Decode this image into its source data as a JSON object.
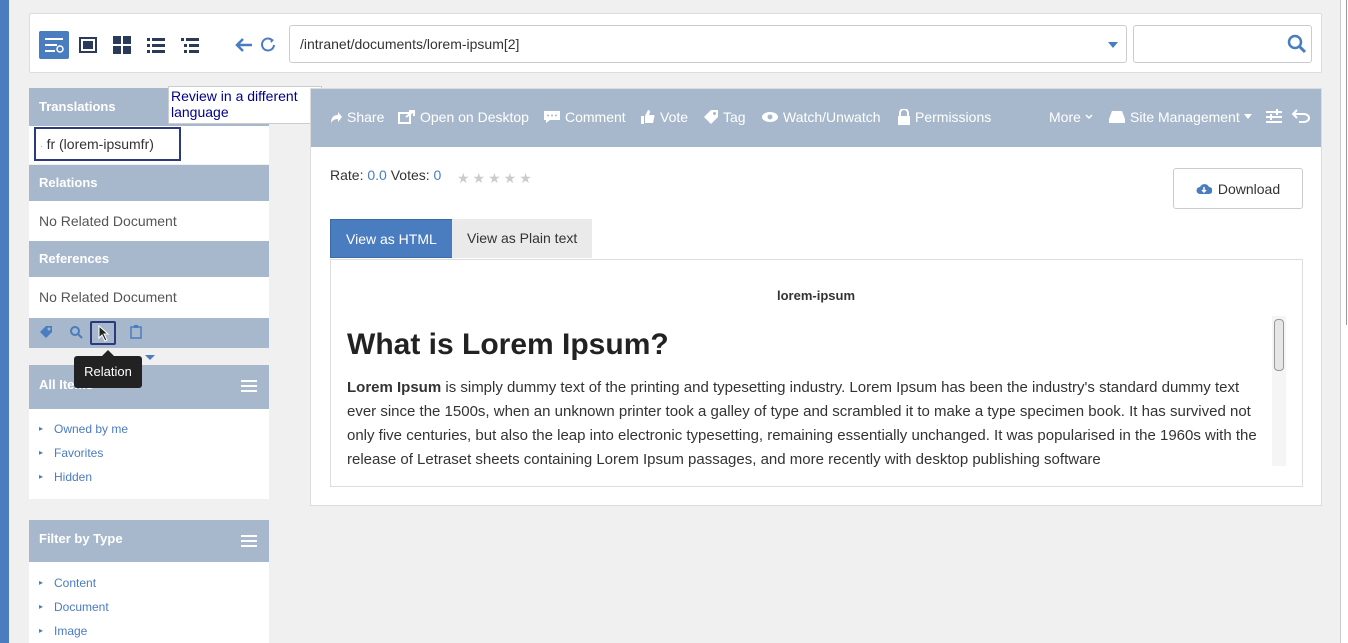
{
  "toolbar": {
    "path_value": "/intranet/documents/lorem-ipsum[2]",
    "search_value": ""
  },
  "sidebar": {
    "translations_heading": "Translations",
    "translations_tooltip": "Review in a different language",
    "translation_item": "fr (lorem-ipsumfr)",
    "relations_heading": "Relations",
    "relations_empty": "No Related Document",
    "references_heading": "References",
    "references_empty": "No Related Document",
    "relation_tooltip": "Relation",
    "all_items_heading": "All Items",
    "all_items": [
      "Owned by me",
      "Favorites",
      "Hidden"
    ],
    "filter_heading": "Filter by Type",
    "filter_items": [
      "Content",
      "Document",
      "Image"
    ]
  },
  "actions": {
    "share": "Share",
    "open_desktop": "Open on Desktop",
    "comment": "Comment",
    "vote": "Vote",
    "tag": "Tag",
    "watch": "Watch/Unwatch",
    "permissions": "Permissions",
    "more": "More",
    "site_management": "Site Management"
  },
  "rating": {
    "rate_label": "Rate:",
    "rate_value": "0.0",
    "votes_label": "Votes:",
    "votes_value": "0",
    "stars": 0
  },
  "download_label": "Download",
  "tabs": {
    "html": "View as HTML",
    "plain": "View as Plain text"
  },
  "document": {
    "title": "lorem-ipsum",
    "heading": "What is Lorem Ipsum?",
    "lead": "Lorem Ipsum",
    "body": " is simply dummy text of the printing and typesetting industry. Lorem Ipsum has been the industry's standard dummy text ever since the 1500s, when an unknown printer took a galley of type and scrambled it to make a type specimen book. It has survived not only five centuries, but also the leap into electronic typesetting, remaining essentially unchanged. It was popularised in the 1960s with the release of Letraset sheets containing Lorem Ipsum passages, and more recently with desktop publishing software"
  },
  "colors": {
    "accent": "#4a7cc0",
    "panel": "#a7b8cc"
  }
}
